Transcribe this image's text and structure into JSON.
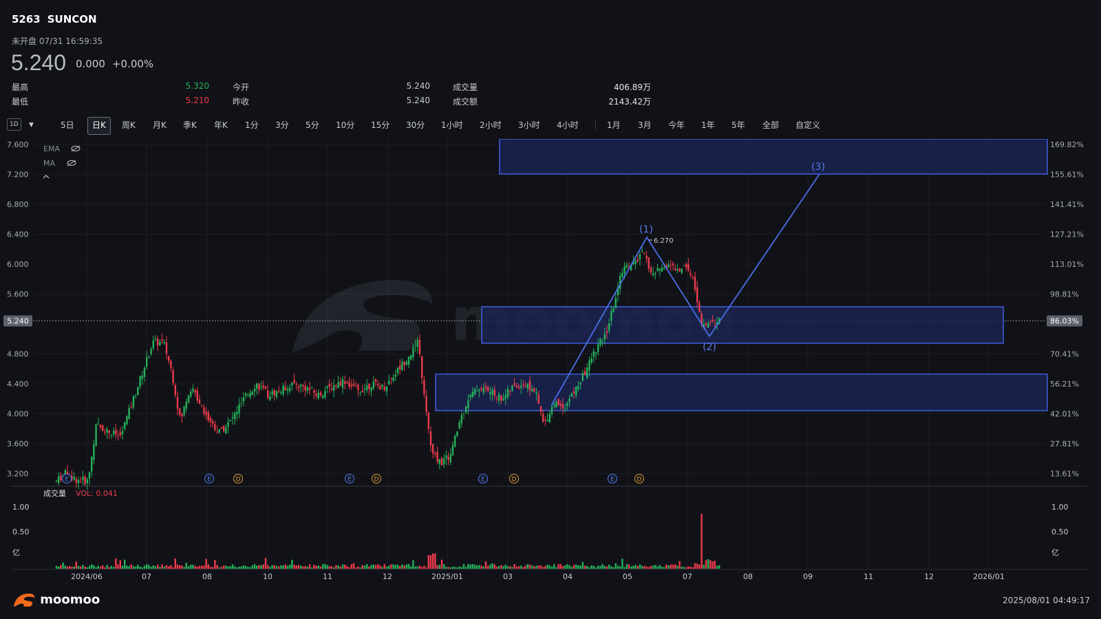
{
  "header": {
    "code": "5263",
    "name": "SUNCON",
    "status": "未开盘 07/31 16:59:35",
    "price": "5.240",
    "change": "0.000",
    "change_pct": "+0.00%"
  },
  "stats": {
    "high_label": "最高",
    "high_value": "5.320",
    "low_label": "最低",
    "low_value": "5.210",
    "open_label": "今开",
    "open_value": "5.240",
    "prev_close_label": "昨收",
    "prev_close_value": "5.240",
    "volume_label": "成交量",
    "volume_value": "406.89万",
    "turnover_label": "成交额",
    "turnover_value": "2143.42万"
  },
  "toolbar": {
    "interval_selector": "1D",
    "timeframes": [
      "5日",
      "日K",
      "周K",
      "月K",
      "季K",
      "年K",
      "1分",
      "3分",
      "5分",
      "10分",
      "15分",
      "30分",
      "1小时",
      "2小时",
      "3小时",
      "4小时"
    ],
    "active": "日K",
    "ranges": [
      "1月",
      "3月",
      "今年",
      "1年",
      "5年",
      "全部",
      "自定义"
    ]
  },
  "chart": {
    "indicators": {
      "ema": "EMA",
      "ma": "MA"
    },
    "collapse_icon": "chevron-up-icon",
    "price_ticks": [
      "7.600",
      "7.200",
      "6.800",
      "6.400",
      "6.000",
      "5.600",
      "5.240",
      "4.800",
      "4.400",
      "4.000",
      "3.600",
      "3.200"
    ],
    "pct_ticks": [
      "169.82%",
      "155.61%",
      "141.41%",
      "127.21%",
      "113.01%",
      "98.81%",
      "86.03%",
      "70.41%",
      "56.21%",
      "42.01%",
      "27.81%",
      "13.61%"
    ],
    "current_price_tag": "5.240",
    "current_pct_tag": "86.03%",
    "peak_label": "6.270",
    "wave_labels": [
      "(1)",
      "(2)",
      "(3)"
    ],
    "event_markers": [
      "E",
      "E",
      "D",
      "E",
      "D",
      "E",
      "D",
      "E",
      "D"
    ],
    "x_ticks": [
      "2024/06",
      "07",
      "08",
      "10",
      "11",
      "12",
      "2025/01",
      "03",
      "04",
      "05",
      "07",
      "08",
      "09",
      "11",
      "12",
      "2026/01"
    ],
    "volume_label": "成交量",
    "volume_reading": "VOL: 0.041",
    "volume_ticks": [
      "1.00",
      "0.50",
      "亿"
    ],
    "watermark": "moomoo",
    "colors": {
      "up": "#25b35b",
      "down": "#ee3b4d",
      "zone_border": "#3f5fe0",
      "zone_fill": "#1a2350",
      "wave_line": "#4a6ee8"
    }
  },
  "footer": {
    "brand": "moomoo",
    "timestamp": "2025/08/01 04:49:17"
  }
}
